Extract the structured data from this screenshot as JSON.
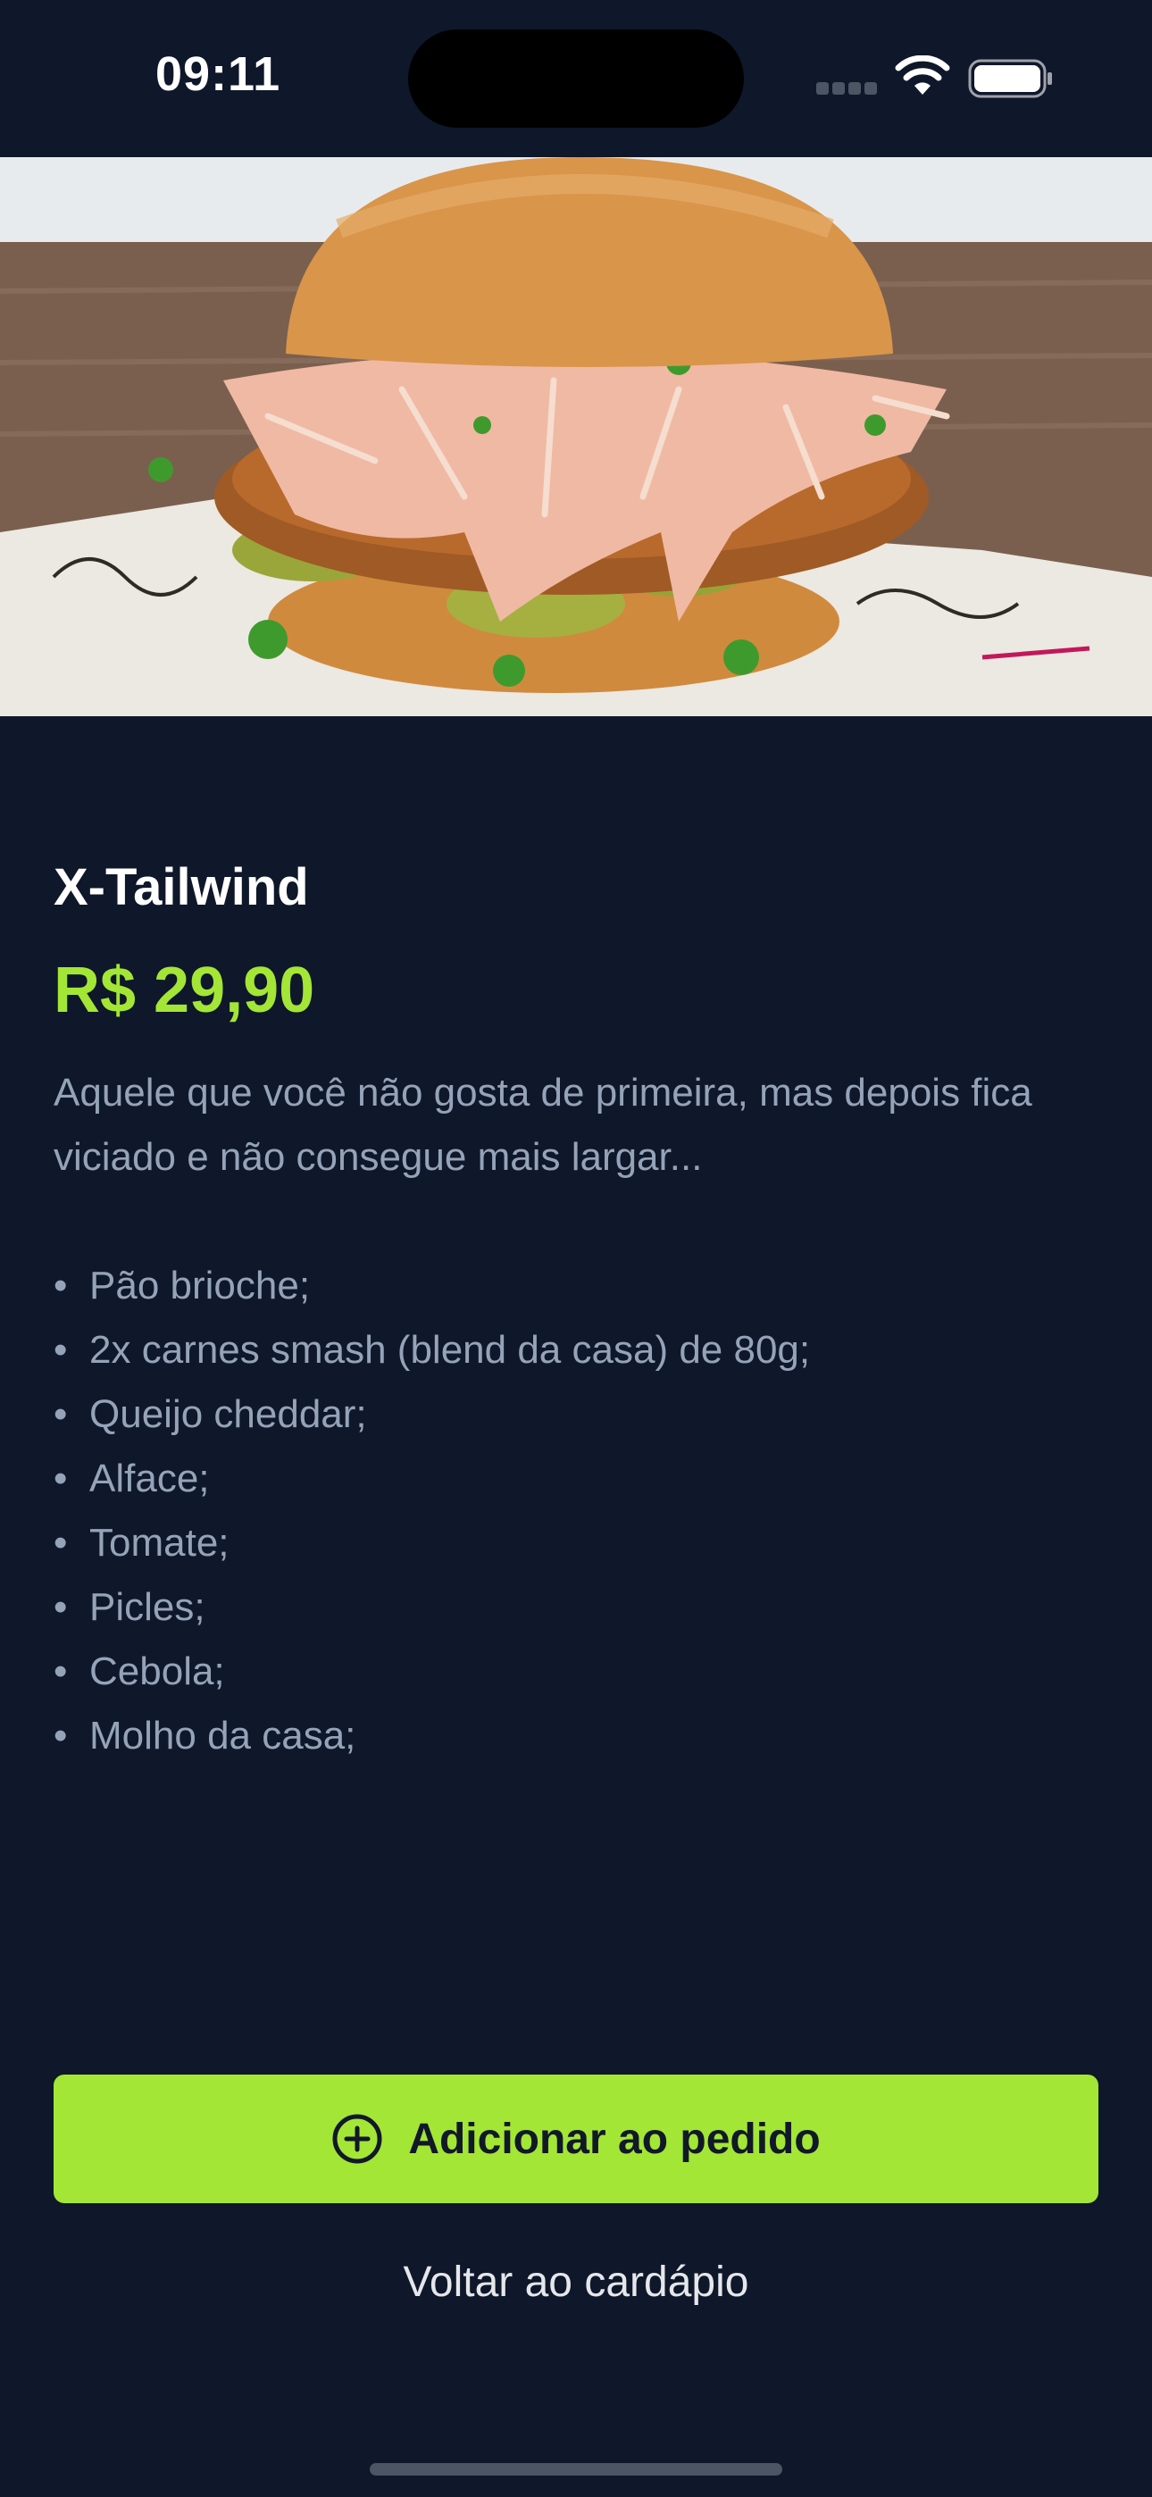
{
  "status_bar": {
    "time": "09:11",
    "icons": [
      "signal-icon",
      "wifi-icon",
      "battery-icon"
    ]
  },
  "hero": {
    "image": "burger-photo"
  },
  "product": {
    "title": "X-Tailwind",
    "price": "R$ 29,90",
    "description": "Aquele que você não gosta de primeira, mas depois fica viciado e não consegue mais largar...",
    "ingredients": [
      "Pão brioche;",
      "2x carnes smash (blend da casa) de 80g;",
      "Queijo cheddar;",
      "Alface;",
      "Tomate;",
      "Picles;",
      "Cebola;",
      "Molho da casa;"
    ],
    "bullet": "•"
  },
  "actions": {
    "add_label": "Adicionar ao pedido",
    "add_icon": "plus-circle-icon",
    "back_label": "Voltar ao cardápio"
  },
  "colors": {
    "background": "#0f172a",
    "accent": "#a3e635",
    "text_primary": "#ffffff",
    "text_muted": "#94a3b8"
  }
}
